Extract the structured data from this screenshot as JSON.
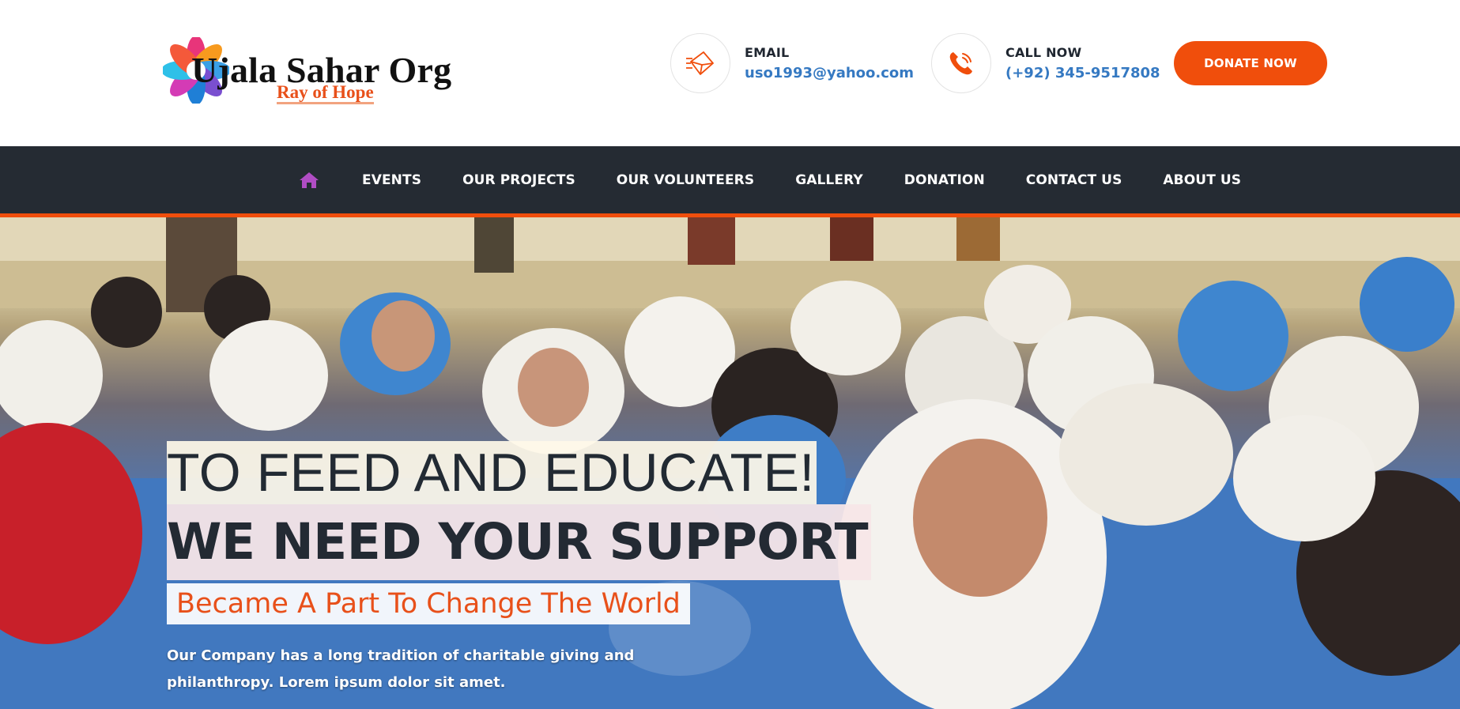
{
  "brand": {
    "name": "Ujala Sahar Org",
    "tagline": "Ray of Hope"
  },
  "contact": {
    "email_label": "EMAIL",
    "email_value": "uso1993@yahoo.com",
    "call_label": "CALL NOW",
    "call_value": "(+92) 345-9517808"
  },
  "cta": {
    "donate_label": "DONATE NOW"
  },
  "nav": {
    "home_icon": "home-icon",
    "items": [
      "EVENTS",
      "OUR PROJECTS",
      "OUR VOLUNTEERS",
      "GALLERY",
      "DONATION",
      "CONTACT US",
      "ABOUT US"
    ]
  },
  "hero": {
    "line1": "TO FEED AND EDUCATE!",
    "line2": "WE NEED YOUR SUPPORT",
    "line3": "Became A Part To Change The World",
    "description": "Our Company has a long tradition of charitable giving and philanthropy. Lorem ipsum dolor sit amet."
  },
  "colors": {
    "accent": "#f04e0c",
    "nav_bg": "#252b33",
    "link_blue": "#3579c2",
    "home_icon": "#b04dc4"
  },
  "icons": {
    "email": "envelope-icon",
    "call": "phone-icon"
  }
}
